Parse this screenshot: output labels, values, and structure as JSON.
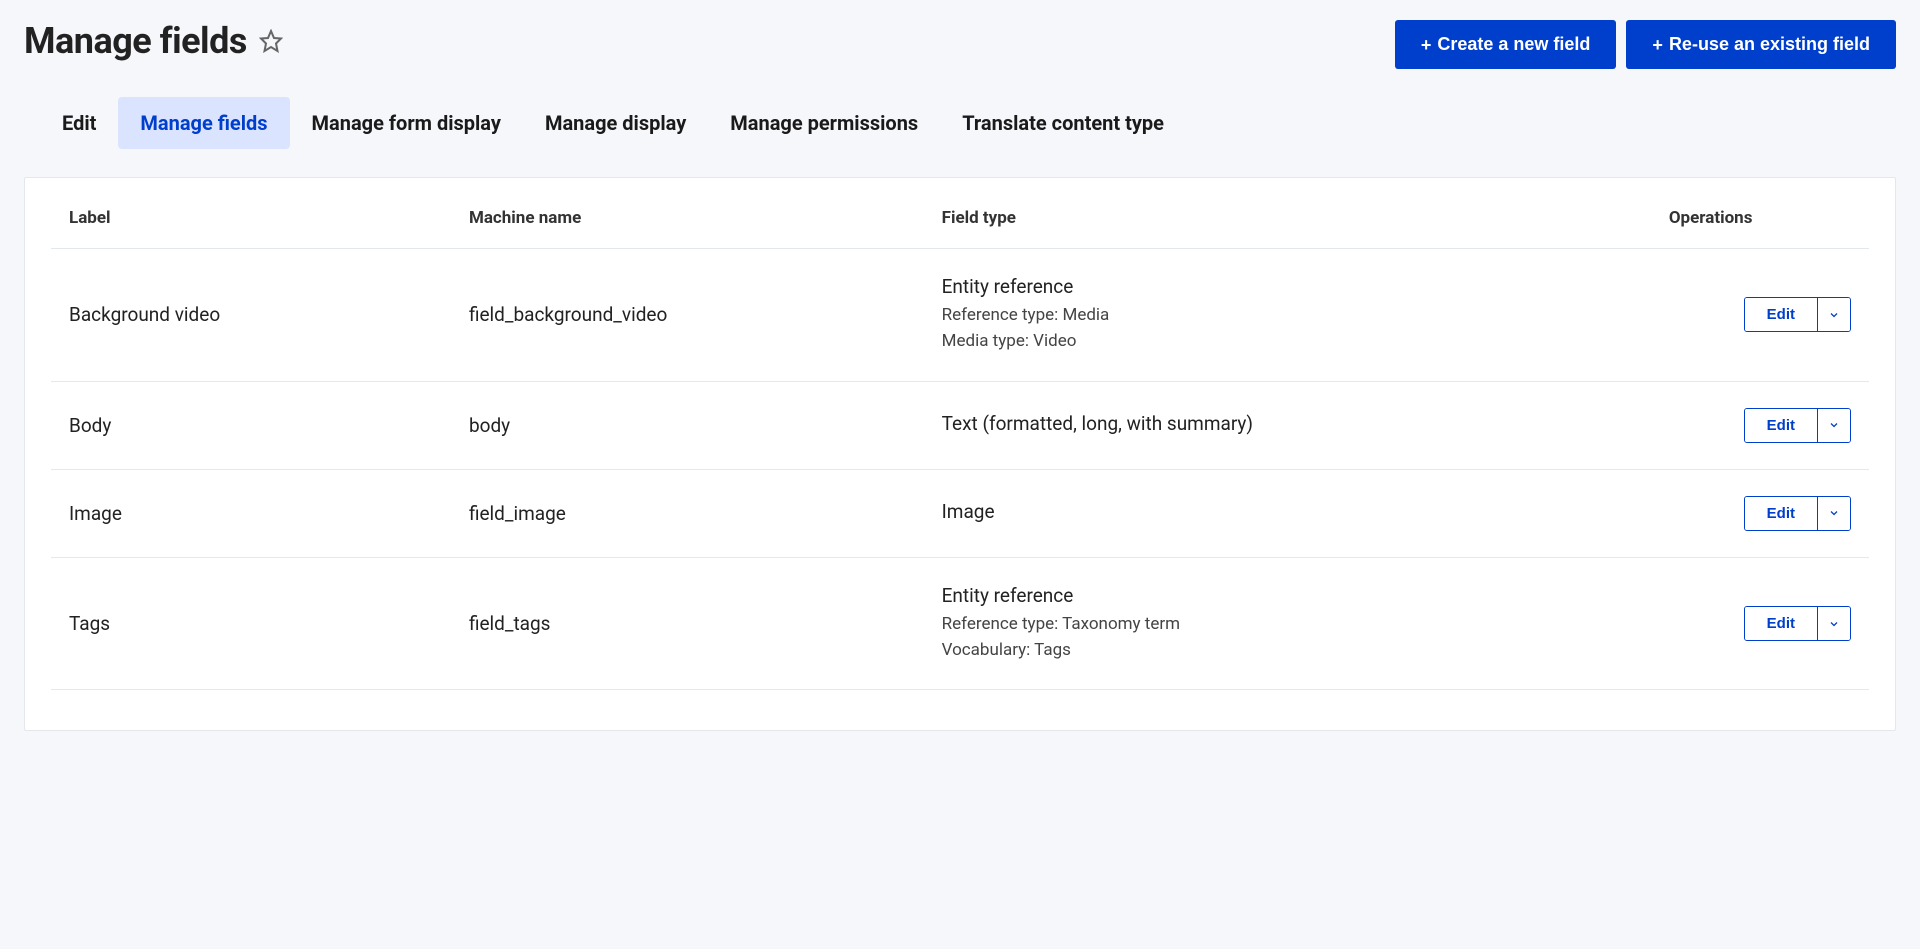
{
  "header": {
    "title": "Manage fields",
    "actions": {
      "create_label": "Create a new field",
      "reuse_label": "Re-use an existing field"
    }
  },
  "tabs": [
    {
      "id": "edit",
      "label": "Edit",
      "active": false
    },
    {
      "id": "manage-fields",
      "label": "Manage fields",
      "active": true
    },
    {
      "id": "manage-form-display",
      "label": "Manage form display",
      "active": false
    },
    {
      "id": "manage-display",
      "label": "Manage display",
      "active": false
    },
    {
      "id": "manage-permissions",
      "label": "Manage permissions",
      "active": false
    },
    {
      "id": "translate",
      "label": "Translate content type",
      "active": false
    }
  ],
  "table": {
    "headers": {
      "label": "Label",
      "machine_name": "Machine name",
      "field_type": "Field type",
      "operations": "Operations"
    },
    "edit_label": "Edit",
    "rows": [
      {
        "label": "Background video",
        "machine_name": "field_background_video",
        "type_main": "Entity reference",
        "type_sub": [
          "Reference type: Media",
          "Media type: Video"
        ]
      },
      {
        "label": "Body",
        "machine_name": "body",
        "type_main": "Text (formatted, long, with summary)",
        "type_sub": []
      },
      {
        "label": "Image",
        "machine_name": "field_image",
        "type_main": "Image",
        "type_sub": []
      },
      {
        "label": "Tags",
        "machine_name": "field_tags",
        "type_main": "Entity reference",
        "type_sub": [
          "Reference type: Taxonomy term",
          "Vocabulary: Tags"
        ]
      }
    ]
  }
}
